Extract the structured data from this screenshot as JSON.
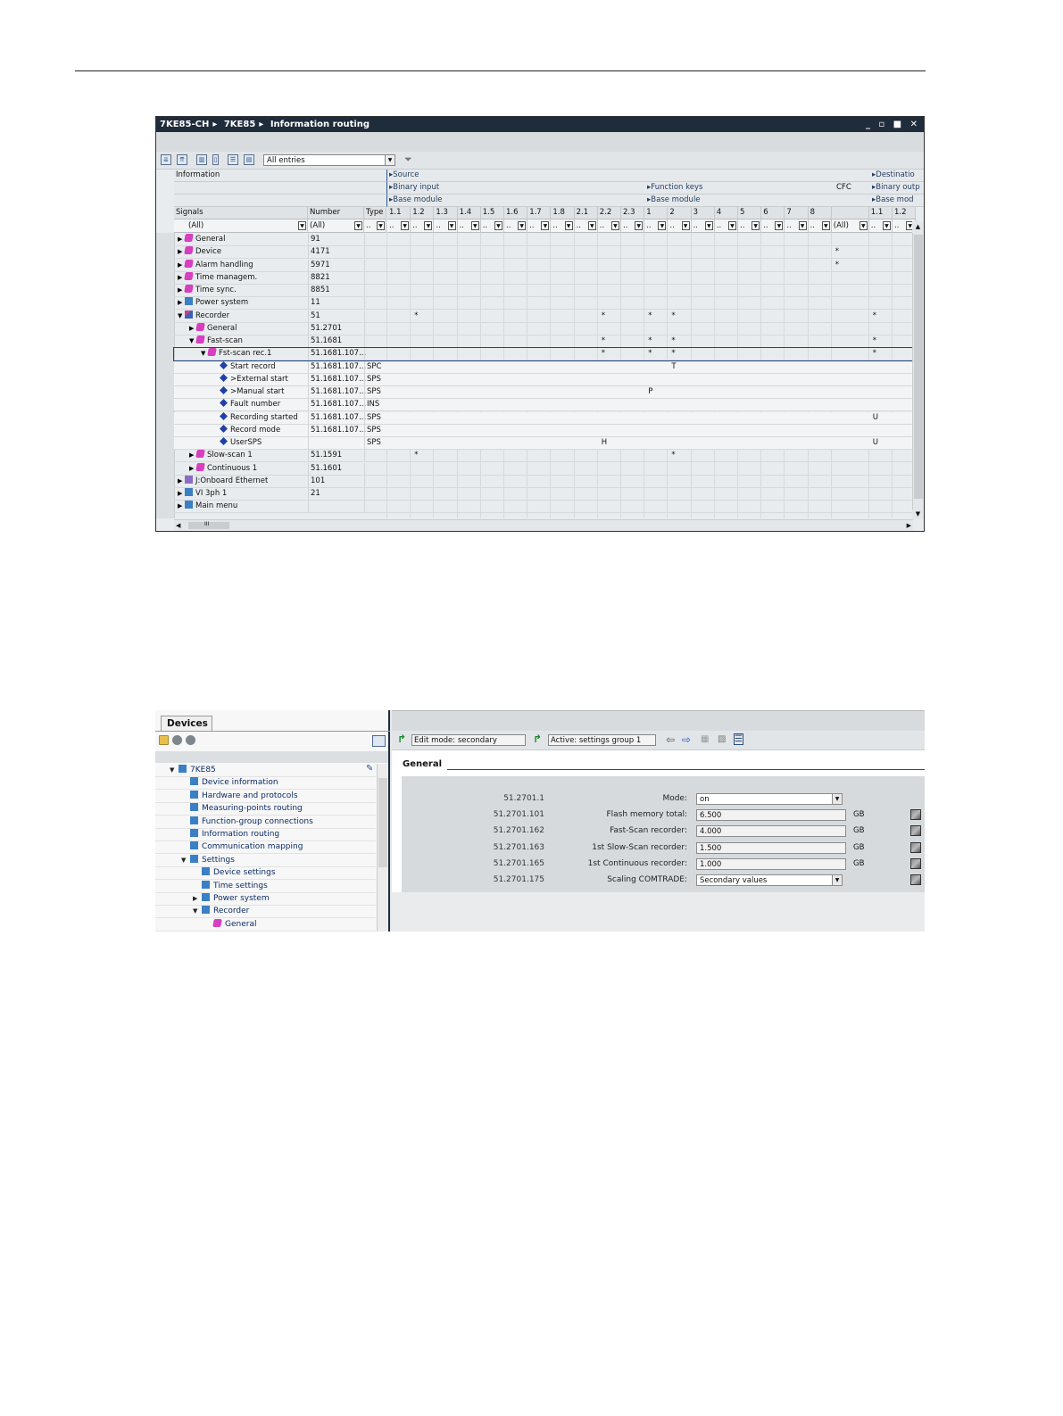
{
  "routing": {
    "breadcrumb": [
      "7KE85-CH",
      "7KE85",
      "Information routing"
    ],
    "window_controls": "_ ▫ ■ ✕",
    "filter_select": "All entries",
    "header_rows": {
      "information": "Information",
      "source": "Source",
      "destination": "Destinatio",
      "binary_input": "Binary input",
      "function_keys": "Function keys",
      "cfc": "CFC",
      "binary_output": "Binary outp",
      "base_module_1": "Base module",
      "base_module_2": "Base module",
      "base_module_3": "Base mod"
    },
    "col_signals": "Signals",
    "col_number": "Number",
    "col_type": "Type",
    "bi_cols": [
      "1.1",
      "1.2",
      "1.3",
      "1.4",
      "1.5",
      "1.6",
      "1.7",
      "1.8",
      "2.1",
      "2.2",
      "2.3"
    ],
    "fk_cols": [
      "1",
      "2",
      "3",
      "4",
      "5",
      "6",
      "7",
      "8"
    ],
    "bo_cols": [
      "1.1",
      "1.2"
    ],
    "filters": {
      "signals": "(All)",
      "number": "(All)",
      "cfc": "(All)"
    },
    "rows": [
      {
        "indent": 0,
        "expand": "▶",
        "icon": "pink",
        "signal": "General",
        "number": "91",
        "type": "",
        "marks": []
      },
      {
        "indent": 0,
        "expand": "▶",
        "icon": "pink",
        "signal": "Device",
        "number": "4171",
        "type": "",
        "marks": [
          {
            "col": "cfc",
            "v": "*"
          }
        ]
      },
      {
        "indent": 0,
        "expand": "▶",
        "icon": "pink",
        "signal": "Alarm handling",
        "number": "5971",
        "type": "",
        "marks": [
          {
            "col": "cfc",
            "v": "*"
          }
        ]
      },
      {
        "indent": 0,
        "expand": "▶",
        "icon": "pink",
        "signal": "Time managem.",
        "number": "8821",
        "type": "",
        "marks": []
      },
      {
        "indent": 0,
        "expand": "▶",
        "icon": "pink",
        "signal": "Time sync.",
        "number": "8851",
        "type": "",
        "marks": []
      },
      {
        "indent": 0,
        "expand": "▶",
        "icon": "teal",
        "signal": "Power system",
        "number": "11",
        "type": "",
        "marks": []
      },
      {
        "indent": 0,
        "expand": "▼",
        "icon": "rec",
        "signal": "Recorder",
        "number": "51",
        "type": "",
        "marks": [
          {
            "col": "bi1",
            "v": "*"
          },
          {
            "col": "bi9",
            "v": "*"
          },
          {
            "col": "fk0",
            "v": "*"
          },
          {
            "col": "fk1",
            "v": "*"
          },
          {
            "col": "bo0",
            "v": "*"
          }
        ]
      },
      {
        "indent": 1,
        "expand": "▶",
        "icon": "pink",
        "signal": "General",
        "number": "51.2701",
        "type": "",
        "marks": []
      },
      {
        "indent": 1,
        "expand": "▼",
        "icon": "pink",
        "signal": "Fast-scan",
        "number": "51.1681",
        "type": "",
        "marks": [
          {
            "col": "bi9",
            "v": "*"
          },
          {
            "col": "fk0",
            "v": "*"
          },
          {
            "col": "fk1",
            "v": "*"
          },
          {
            "col": "bo0",
            "v": "*"
          }
        ]
      },
      {
        "indent": 2,
        "expand": "▼",
        "icon": "pink",
        "signal": "Fst-scan rec.1",
        "number": "51.1681.107...",
        "type": "",
        "selected": true,
        "marks": [
          {
            "col": "bi9",
            "v": "*"
          },
          {
            "col": "fk0",
            "v": "*"
          },
          {
            "col": "fk1",
            "v": "*"
          },
          {
            "col": "bo0",
            "v": "*"
          }
        ]
      },
      {
        "indent": 3,
        "expand": "",
        "icon": "blue",
        "signal": "Start record",
        "number": "51.1681.107...",
        "type": "SPC",
        "marks": [
          {
            "col": "fk1",
            "v": "T"
          }
        ]
      },
      {
        "indent": 3,
        "expand": "",
        "icon": "blue",
        "signal": ">External start",
        "number": "51.1681.107...",
        "type": "SPS",
        "marks": []
      },
      {
        "indent": 3,
        "expand": "",
        "icon": "blue",
        "signal": ">Manual start",
        "number": "51.1681.107...",
        "type": "SPS",
        "marks": [
          {
            "col": "fk0",
            "v": "P"
          }
        ]
      },
      {
        "indent": 3,
        "expand": "",
        "icon": "blue",
        "signal": "Fault number",
        "number": "51.1681.107...",
        "type": "INS",
        "marks": []
      },
      {
        "indent": 3,
        "expand": "",
        "icon": "blue",
        "signal": "Recording started",
        "number": "51.1681.107...",
        "type": "SPS",
        "marks": [
          {
            "col": "bo0",
            "v": "U"
          }
        ]
      },
      {
        "indent": 3,
        "expand": "",
        "icon": "blue",
        "signal": "Record mode",
        "number": "51.1681.107...",
        "type": "SPS",
        "marks": []
      },
      {
        "indent": 3,
        "expand": "",
        "icon": "blue",
        "signal": "UserSPS",
        "number": "",
        "type": "SPS",
        "marks": [
          {
            "col": "bi9",
            "v": "H"
          },
          {
            "col": "bo0",
            "v": "U"
          }
        ]
      },
      {
        "indent": 1,
        "expand": "▶",
        "icon": "pink",
        "signal": "Slow-scan 1",
        "number": "51.1591",
        "type": "",
        "marks": [
          {
            "col": "bi1",
            "v": "*"
          },
          {
            "col": "fk1",
            "v": "*"
          }
        ]
      },
      {
        "indent": 1,
        "expand": "▶",
        "icon": "pink",
        "signal": "Continuous 1",
        "number": "51.1601",
        "type": "",
        "marks": []
      },
      {
        "indent": 0,
        "expand": "▶",
        "icon": "purp",
        "signal": "J:Onboard Ethernet",
        "number": "101",
        "type": "",
        "marks": []
      },
      {
        "indent": 0,
        "expand": "▶",
        "icon": "teal",
        "signal": "VI 3ph 1",
        "number": "21",
        "type": "",
        "marks": []
      },
      {
        "indent": 0,
        "expand": "▶",
        "icon": "teal",
        "signal": "Main menu",
        "number": "",
        "type": "",
        "marks": []
      }
    ],
    "hscroll_label": "III"
  },
  "devices": {
    "tab_label": "Devices",
    "tree": [
      {
        "indent": 0,
        "expand": "▼",
        "label": "7KE85"
      },
      {
        "indent": 1,
        "expand": "",
        "label": "Device information"
      },
      {
        "indent": 1,
        "expand": "",
        "label": "Hardware and protocols"
      },
      {
        "indent": 1,
        "expand": "",
        "label": "Measuring-points routing"
      },
      {
        "indent": 1,
        "expand": "",
        "label": "Function-group connections"
      },
      {
        "indent": 1,
        "expand": "",
        "label": "Information routing"
      },
      {
        "indent": 1,
        "expand": "",
        "label": "Communication mapping"
      },
      {
        "indent": 1,
        "expand": "▼",
        "label": "Settings"
      },
      {
        "indent": 2,
        "expand": "",
        "label": "Device settings"
      },
      {
        "indent": 2,
        "expand": "",
        "label": "Time settings"
      },
      {
        "indent": 2,
        "expand": "▶",
        "label": "Power system"
      },
      {
        "indent": 2,
        "expand": "▼",
        "label": "Recorder"
      },
      {
        "indent": 3,
        "expand": "",
        "label": "General"
      }
    ],
    "edit_mode": "Edit mode: secondary",
    "active_group": "Active: settings group 1",
    "section_title": "General",
    "params": [
      {
        "id": "51.2701.1",
        "label": "Mode:",
        "value": "on",
        "unit": "",
        "dropdown": true,
        "edit": false
      },
      {
        "id": "51.2701.101",
        "label": "Flash memory total:",
        "value": "6.500",
        "unit": "GB",
        "dropdown": false,
        "edit": true
      },
      {
        "id": "51.2701.162",
        "label": "Fast-Scan recorder:",
        "value": "4.000",
        "unit": "GB",
        "dropdown": false,
        "edit": true
      },
      {
        "id": "51.2701.163",
        "label": "1st Slow-Scan recorder:",
        "value": "1.500",
        "unit": "GB",
        "dropdown": false,
        "edit": true
      },
      {
        "id": "51.2701.165",
        "label": "1st Continuous recorder:",
        "value": "1.000",
        "unit": "GB",
        "dropdown": false,
        "edit": true
      },
      {
        "id": "51.2701.175",
        "label": "Scaling COMTRADE:",
        "value": "Secondary values",
        "unit": "",
        "dropdown": true,
        "edit": true
      }
    ]
  }
}
